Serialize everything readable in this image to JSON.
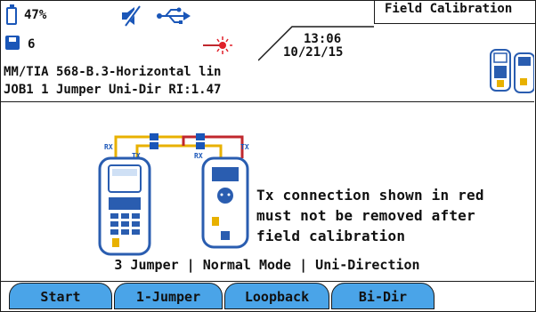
{
  "status": {
    "battery": "47%",
    "saved_count": "6",
    "time": "13:06",
    "date": "10/21/15"
  },
  "header": {
    "title": "Field Calibration",
    "test_limit": "MM/TIA 568-B.3-Horizontal lin",
    "job_info": "JOB1 1 Jumper Uni-Dir RI:1.47"
  },
  "diagram": {
    "rx_left": "RX",
    "tx_left": "TX",
    "rx_right": "RX",
    "tx_right": "TX"
  },
  "message": {
    "line1": "Tx connection shown in red",
    "line2": "must not be removed after",
    "line3": "field calibration"
  },
  "summary": "3 Jumper | Normal Mode | Uni-Direction",
  "softkeys": [
    "Start",
    "1-Jumper",
    "Loopback",
    "Bi-Dir"
  ],
  "colors": {
    "softkey": "#4aa4e8",
    "tx_fiber": "#c0272d",
    "rx_fiber": "#e8b100",
    "icon_blue": "#1a56b8"
  },
  "icons": [
    "battery-icon",
    "floppy-disk-icon",
    "speaker-muted-icon",
    "usb-icon",
    "laser-active-icon",
    "meter-pair-icon"
  ]
}
